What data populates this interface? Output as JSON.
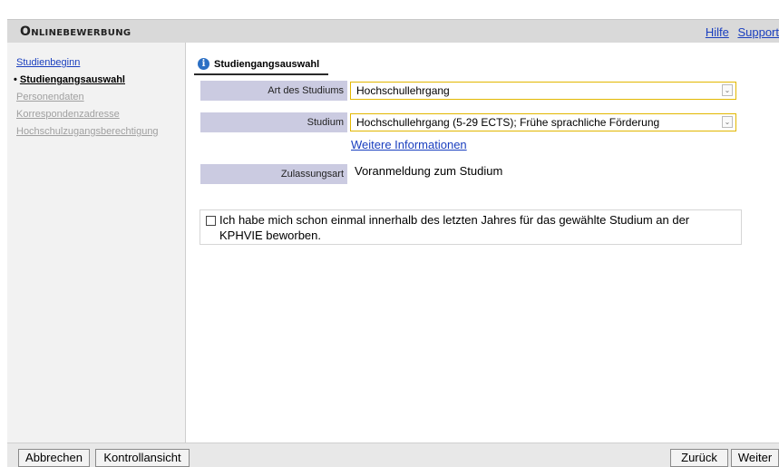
{
  "header": {
    "title": "Onlinebewerbung",
    "links": {
      "help": "Hilfe",
      "support": "Support"
    }
  },
  "sidebar": {
    "items": [
      {
        "label": "Studienbeginn",
        "state": "done"
      },
      {
        "label": "Studiengangsauswahl",
        "state": "active"
      },
      {
        "label": "Personendaten",
        "state": "disabled"
      },
      {
        "label": "Korrespondenzadresse",
        "state": "disabled"
      },
      {
        "label": "Hochschulzugangsberechtigung",
        "state": "disabled"
      }
    ],
    "active_bullet": "•"
  },
  "main": {
    "tab_label": "Studiengangsauswahl",
    "tab_icon": "info-icon",
    "fields": {
      "art": {
        "label": "Art des Studiums",
        "value": "Hochschullehrgang"
      },
      "studium": {
        "label": "Studium",
        "value": "Hochschullehrgang (5-29 ECTS); Frühe sprachliche Förderung"
      },
      "more_info": "Weitere Informationen",
      "zulassung": {
        "label": "Zulassungsart",
        "value": "Voranmeldung zum Studium"
      }
    },
    "checkbox": {
      "checked": false,
      "label": "Ich habe mich schon einmal innerhalb des letzten Jahres für das gewählte Studium an der KPHVIE beworben."
    }
  },
  "footer": {
    "cancel": "Abbrechen",
    "review": "Kontrollansicht",
    "back": "Zurück",
    "next": "Weiter"
  },
  "colors": {
    "header_bg": "#d9d9d9",
    "label_bg": "#cbcbe1",
    "select_border": "#e2b700",
    "link": "#1a3fbf"
  }
}
